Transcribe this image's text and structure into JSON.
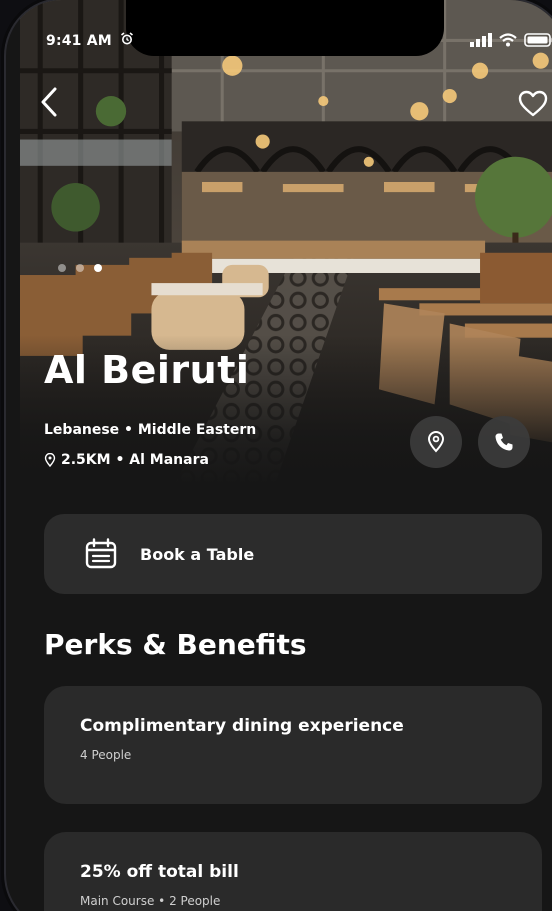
{
  "status_bar": {
    "time": "9:41 AM"
  },
  "restaurant": {
    "name": "Al Beiruti",
    "cuisine": "Lebanese • Middle Eastern",
    "location": "2.5KM • Al Manara"
  },
  "carousel": {
    "total": 3,
    "active": 3
  },
  "actions": {
    "book_label": "Book a Table"
  },
  "perks": {
    "title": "Perks & Benefits",
    "items": [
      {
        "title": "Complimentary dining experience",
        "subtitle": "4 People"
      },
      {
        "title": "25% off total bill",
        "subtitle": "Main Course • 2 People"
      }
    ]
  },
  "colors": {
    "background": "#161616",
    "card": "#2c2c2c",
    "text": "#ffffff",
    "muted": "#cfcfcf"
  },
  "icons": [
    "alarm-icon",
    "signal-icon",
    "wifi-icon",
    "battery-icon",
    "back-chevron-icon",
    "heart-icon",
    "map-pin-icon",
    "phone-icon",
    "calendar-icon"
  ]
}
